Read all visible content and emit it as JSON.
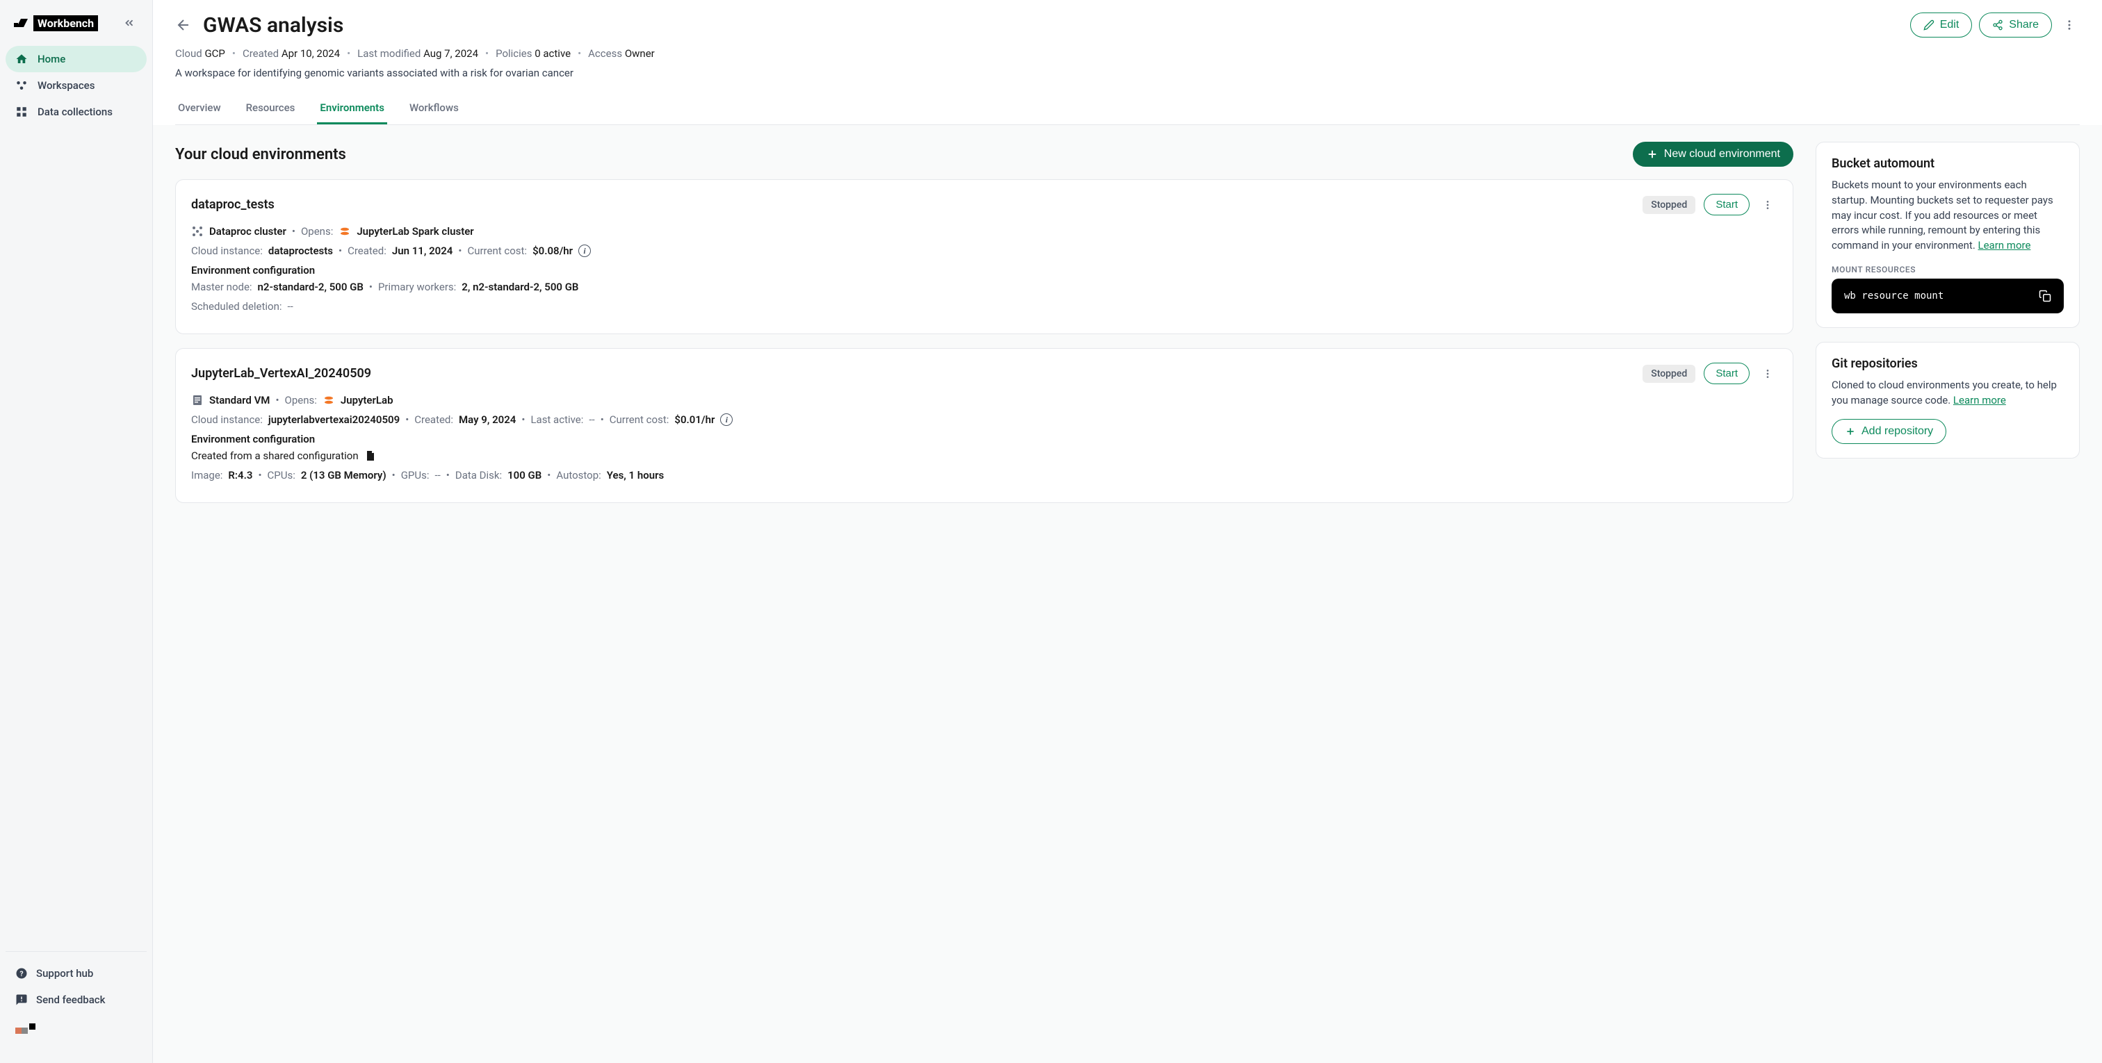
{
  "brand": "Workbench",
  "nav": {
    "home": "Home",
    "workspaces": "Workspaces",
    "datacollections": "Data collections",
    "support": "Support hub",
    "feedback": "Send feedback"
  },
  "header": {
    "title": "GWAS analysis",
    "edit": "Edit",
    "share": "Share",
    "cloud_label": "Cloud",
    "cloud_value": "GCP",
    "created_label": "Created",
    "created_value": "Apr 10, 2024",
    "modified_label": "Last modified",
    "modified_value": "Aug 7, 2024",
    "policies_label": "Policies",
    "policies_value": "0 active",
    "access_label": "Access",
    "access_value": "Owner",
    "description": "A workspace for identifying genomic variants associated with a risk for ovarian cancer"
  },
  "tabs": {
    "overview": "Overview",
    "resources": "Resources",
    "environments": "Environments",
    "workflows": "Workflows"
  },
  "envs": {
    "section_title": "Your cloud environments",
    "new_btn": "New cloud environment",
    "start": "Start",
    "stopped": "Stopped",
    "cloud_instance": "Cloud instance:",
    "created": "Created:",
    "last_active": "Last active:",
    "current_cost": "Current cost:",
    "opens": "Opens:",
    "config_heading": "Environment configuration",
    "master_node": "Master node:",
    "primary_workers": "Primary workers:",
    "scheduled_deletion": "Scheduled deletion:",
    "created_from_shared": "Created from a shared configuration",
    "image": "Image:",
    "cpus": "CPUs:",
    "gpus": "GPUs:",
    "data_disk": "Data Disk:",
    "autostop": "Autostop:"
  },
  "env1": {
    "name": "dataproc_tests",
    "type": "Dataproc cluster",
    "opens": "JupyterLab Spark cluster",
    "instance": "dataproctests",
    "created": "Jun 11, 2024",
    "cost": "$0.08/hr",
    "master_node": "n2-standard-2, 500 GB",
    "primary_workers": "2, n2-standard-2, 500 GB",
    "scheduled_deletion": "--"
  },
  "env2": {
    "name": "JupyterLab_VertexAI_20240509",
    "type": "Standard VM",
    "opens": "JupyterLab",
    "instance": "jupyterlabvertexai20240509",
    "created": "May 9, 2024",
    "last_active": "--",
    "cost": "$0.01/hr",
    "image": "R:4.3",
    "cpus": "2 (13 GB Memory)",
    "gpus": "--",
    "data_disk": "100 GB",
    "autostop": "Yes, 1 hours"
  },
  "bucket": {
    "title": "Bucket automount",
    "body": "Buckets mount to your environments each startup. Mounting buckets set to requester pays may incur cost. If you add resources or meet errors while running, remount by entering this command in your environment. ",
    "learn_more": "Learn more",
    "mount_label": "MOUNT RESOURCES",
    "command": "wb resource mount"
  },
  "git": {
    "title": "Git repositories",
    "body": "Cloned to cloud environments you create, to help you manage source code. ",
    "learn_more": "Learn more",
    "add_btn": "Add repository"
  }
}
